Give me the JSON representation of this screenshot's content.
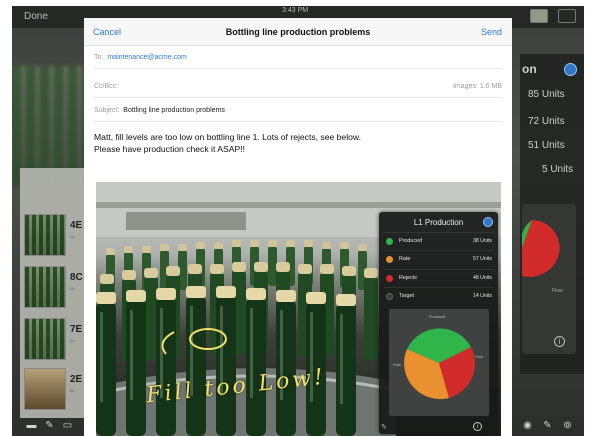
{
  "status": {
    "done_label": "Done",
    "time": "3:43 PM"
  },
  "compose": {
    "cancel_label": "Cancel",
    "title": "Bottling line production problems",
    "send_label": "Send",
    "to_label": "To:",
    "to_value": "maintenance@acme.com",
    "ccbcc_label": "Cc/Bcc:",
    "images_label": "Images: 1.6 MB",
    "subject_label": "Subject:",
    "subject_value": "Bottling line production problems",
    "body_line1": "Matt, fill levels are too low on bottling line 1.  Lots of rejects, see below.",
    "body_line2": "Please have production check it ASAP!!",
    "annotation": "Fill too Low!"
  },
  "l1_card": {
    "title": "L1 Production",
    "metrics": [
      {
        "label": "Produced",
        "value": "38 Units",
        "color": "#2fb54a"
      },
      {
        "label": "Rate",
        "value": "57 Units",
        "color": "#e8912e"
      },
      {
        "label": "Rejects",
        "value": "48 Units",
        "color": "#d12b2b"
      },
      {
        "label": "Target",
        "value": "14 Units",
        "color": "#3a3a3a"
      }
    ],
    "pie_labels": {
      "top": "Produced",
      "left": "Rate",
      "right": "Flow"
    }
  },
  "side_panel": {
    "header": "on",
    "units": [
      "85 Units",
      "72 Units",
      "51 Units",
      "5 Units"
    ],
    "flow_label": "Flow"
  },
  "left_panel": {
    "rows": [
      {
        "num": "4E",
        "sub": "Cr"
      },
      {
        "num": "8C",
        "sub": "Cr"
      },
      {
        "num": "7E",
        "sub": "Cr"
      },
      {
        "num": "2E",
        "sub": "Cr"
      }
    ]
  },
  "icons": {
    "info": "info-icon",
    "pen": "pen-icon",
    "trash": "trash-icon",
    "compose": "compose-icon"
  }
}
